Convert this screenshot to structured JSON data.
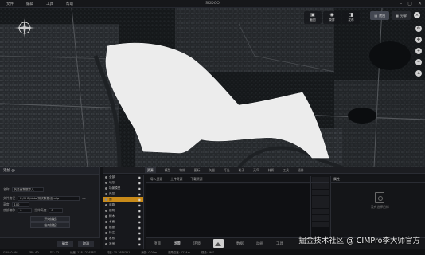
{
  "menu": {
    "items": [
      "文件",
      "编辑",
      "工具",
      "帮助"
    ],
    "title": "SKIDOO"
  },
  "map_toolbar": {
    "tools": [
      {
        "icon": "picture-icon",
        "label": "截图"
      },
      {
        "icon": "video-icon",
        "label": "录屏"
      },
      {
        "icon": "photo-icon",
        "label": "发布"
      }
    ],
    "views": [
      {
        "icon": "layers-icon",
        "label": "底图"
      },
      {
        "icon": "grid-icon",
        "label": "分屏"
      }
    ]
  },
  "import_panel": {
    "title": "添加 @",
    "name_label": "名称",
    "name_value": "矢量面数据导入",
    "file_label": "文件路径",
    "file_value": "E:/SHP/data/测试数据/面.shp",
    "height_label": "高度",
    "height_value": "100",
    "offset_label": "底部偏移",
    "offset_value": "0",
    "extrude_label": "拉伸高度",
    "extrude_value": "0",
    "buttons": [
      "开始拔起",
      "结束拔起"
    ],
    "ok": "确定",
    "cancel": "取消"
  },
  "layers": {
    "header": "图层",
    "items": [
      "全部",
      "地形",
      "场景模型",
      "矢量",
      "面",
      "道路",
      "建筑",
      "树木",
      "水面",
      "植被",
      "标注",
      "水系",
      "其他"
    ]
  },
  "tabs": [
    "资源",
    "模型",
    "特效",
    "图标",
    "矢量",
    "灯光",
    "粒子",
    "天气",
    "材质",
    "工具",
    "插件"
  ],
  "content_toolbar": [
    "导入资源",
    "上传资源",
    "下载资源"
  ],
  "props": {
    "header": "属性",
    "empty": "没有选择目标"
  },
  "modes": [
    "项目",
    "场景",
    "环境",
    "",
    "数据",
    "动画",
    "工具"
  ],
  "status": [
    "GPU: 0.0%",
    "FPS: 60",
    "DX: 12",
    "经度: 118.1234567",
    "纬度: 35.7654321",
    "海拔: 0.00m",
    "视角高度: 1234m",
    "视角: -90°"
  ],
  "watermark": "掘金技术社区 @ CIMPro李大师官方"
}
